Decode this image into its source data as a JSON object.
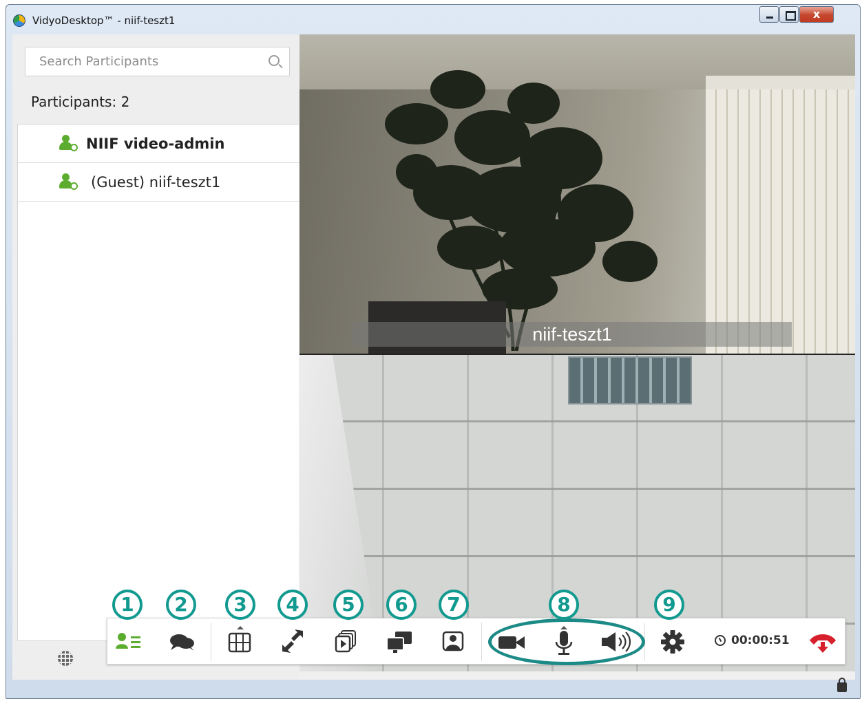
{
  "window": {
    "title": "VidyoDesktop™ - niif-teszt1",
    "close_glyph": "x"
  },
  "search": {
    "placeholder": "Search Participants",
    "value": ""
  },
  "participants": {
    "count_label": "Participants: 2",
    "items": [
      {
        "name": "NIIF video-admin",
        "bold": true,
        "icon": "user-online-icon"
      },
      {
        "name": "(Guest) niif-teszt1",
        "bold": false,
        "icon": "user-online-icon"
      }
    ]
  },
  "video": {
    "remote_name": "niif-teszt1"
  },
  "toolbar": {
    "timer": "00:00:51",
    "callouts": [
      "1",
      "2",
      "3",
      "4",
      "5",
      "6",
      "7",
      "8",
      "9"
    ],
    "icons": [
      "participants-icon",
      "chat-icon",
      "layout-grid-icon",
      "fullscreen-icon",
      "share-content-icon",
      "multi-screen-icon",
      "self-view-icon",
      "camera-icon",
      "microphone-icon",
      "speaker-icon",
      "settings-gear-icon",
      "hangup-icon"
    ]
  },
  "colors": {
    "accent_green": "#5cad2f",
    "callout_teal": "#139a90",
    "hangup_red": "#d7202b"
  }
}
